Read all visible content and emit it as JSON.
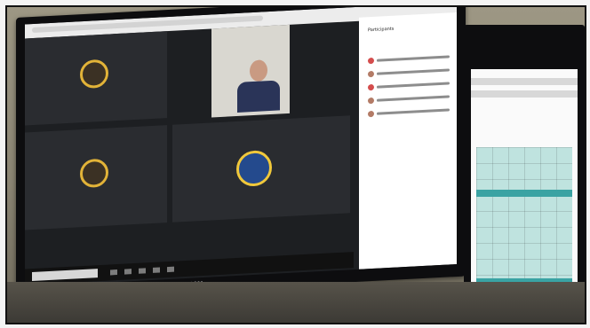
{
  "scene": {
    "description_text": "",
    "monitor": {
      "brand_text": "acer",
      "panel_title": "Participants",
      "tile_names": [
        "",
        "",
        ""
      ]
    }
  },
  "colors": {
    "avatar_ring": "#e2b338",
    "sheet_teal": "#3aa3a3",
    "sheet_yellow": "#e9db8b"
  }
}
